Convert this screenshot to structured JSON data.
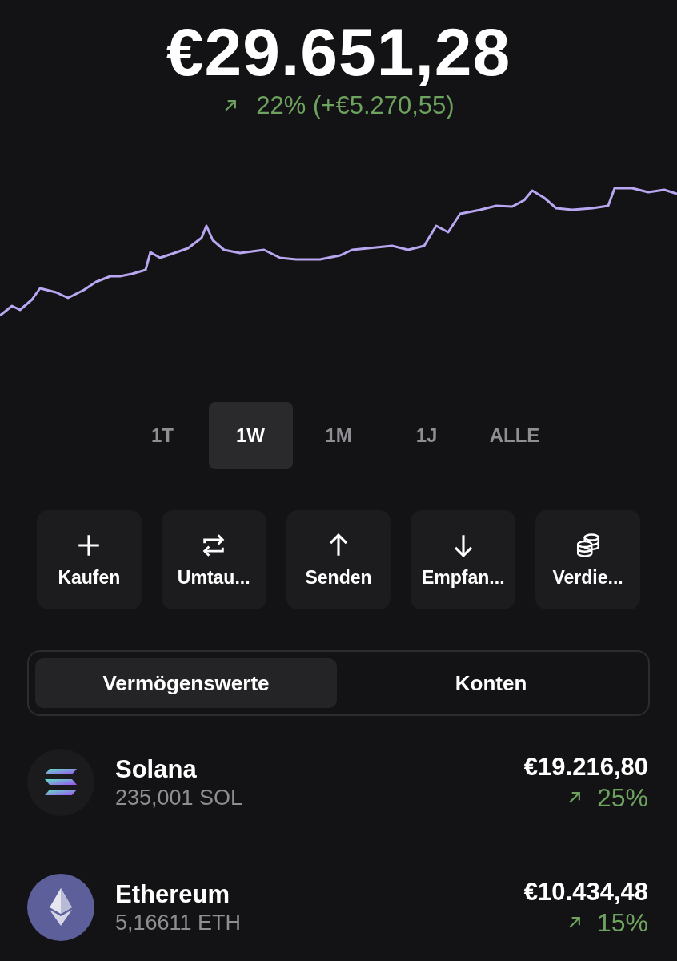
{
  "balance": {
    "value": "€29.651,28",
    "up": true,
    "change": "22% (+€5.270,55)"
  },
  "ranges": [
    {
      "label": "1T",
      "selected": false
    },
    {
      "label": "1W",
      "selected": true
    },
    {
      "label": "1M",
      "selected": false
    },
    {
      "label": "1J",
      "selected": false
    },
    {
      "label": "ALLE",
      "selected": false
    }
  ],
  "actions": [
    {
      "kind": "plus",
      "label": "Kaufen"
    },
    {
      "kind": "swap",
      "label": "Umtau..."
    },
    {
      "kind": "send",
      "label": "Senden"
    },
    {
      "kind": "receive",
      "label": "Empfan..."
    },
    {
      "kind": "coins",
      "label": "Verdie..."
    }
  ],
  "segments": [
    {
      "label": "Vermögenswerte",
      "selected": true
    },
    {
      "label": "Konten",
      "selected": false
    }
  ],
  "assets": [
    {
      "kind": "solana",
      "name": "Solana",
      "amount": "235,001 SOL",
      "value": "€19.216,80",
      "up": true,
      "change": "25%"
    },
    {
      "kind": "ethereum",
      "name": "Ethereum",
      "amount": "5,16611 ETH",
      "value": "€10.434,48",
      "up": true,
      "change": "15%"
    }
  ]
}
